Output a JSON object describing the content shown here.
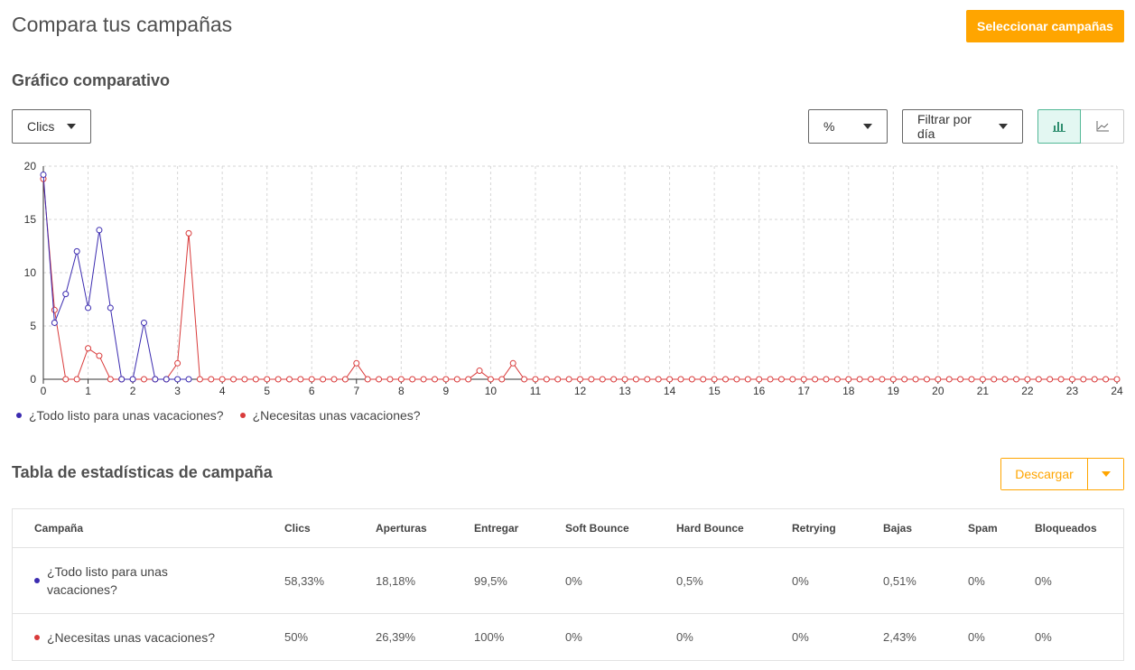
{
  "page": {
    "title": "Compara tus campañas",
    "select_button": "Seleccionar campañas"
  },
  "chart_section": {
    "title": "Gráfico comparativo",
    "metric_select": "Clics",
    "unit_select": "%",
    "filter_select": "Filtrar por día",
    "view_bar_icon": "bar-chart-icon",
    "view_line_icon": "line-chart-icon"
  },
  "chart_data": {
    "type": "line",
    "x": [
      0,
      0.25,
      0.5,
      0.75,
      1,
      1.25,
      1.5,
      1.75,
      2,
      2.25,
      2.5,
      2.75,
      3,
      3.25,
      3.5,
      3.75,
      4,
      4.25,
      4.5,
      4.75,
      5,
      5.25,
      5.5,
      5.75,
      6,
      6.25,
      6.5,
      6.75,
      7,
      7.25,
      7.5,
      7.75,
      8,
      8.25,
      8.5,
      8.75,
      9,
      9.25,
      9.5,
      9.75,
      10,
      10.25,
      10.5,
      10.75,
      11,
      11.25,
      11.5,
      11.75,
      12,
      12.25,
      12.5,
      12.75,
      13,
      13.25,
      13.5,
      13.75,
      14,
      14.25,
      14.5,
      14.75,
      15,
      15.25,
      15.5,
      15.75,
      16,
      16.25,
      16.5,
      16.75,
      17,
      17.25,
      17.5,
      17.75,
      18,
      18.25,
      18.5,
      18.75,
      19,
      19.25,
      19.5,
      19.75,
      20,
      20.25,
      20.5,
      20.75,
      21,
      21.25,
      21.5,
      21.75,
      22,
      22.25,
      22.5,
      22.75,
      23,
      23.25,
      23.5,
      23.75,
      24
    ],
    "series": [
      {
        "name": "¿Todo listo para unas vacaciones?",
        "color": "#3b2bb0",
        "values": [
          19.2,
          5.3,
          8,
          12,
          6.7,
          14,
          6.7,
          0,
          0,
          5.3,
          0,
          0,
          0,
          0
        ]
      },
      {
        "name": "¿Necesitas unas vacaciones?",
        "color": "#d93b3b",
        "values": [
          18.8,
          6.5,
          0,
          0,
          2.9,
          2.2,
          0,
          0,
          0,
          0,
          0,
          0,
          1.5,
          13.7,
          0,
          0,
          0,
          0,
          0,
          0,
          0,
          0,
          0,
          0,
          0,
          0,
          0,
          0,
          1.5,
          0,
          0,
          0,
          0,
          0,
          0,
          0,
          0,
          0,
          0,
          0.8,
          0,
          0,
          1.5,
          0,
          0,
          0,
          0,
          0,
          0,
          0,
          0,
          0,
          0,
          0,
          0,
          0,
          0,
          0,
          0,
          0,
          0,
          0,
          0,
          0,
          0,
          0,
          0,
          0,
          0,
          0,
          0,
          0,
          0,
          0,
          0,
          0,
          0,
          0,
          0,
          0,
          0,
          0,
          0,
          0,
          0,
          0,
          0,
          0,
          0,
          0,
          0,
          0,
          0,
          0,
          0,
          0,
          0
        ]
      }
    ],
    "ylim": [
      0,
      20
    ],
    "yticks": [
      0,
      5,
      10,
      15,
      20
    ],
    "xticks": [
      0,
      1,
      2,
      3,
      4,
      5,
      6,
      7,
      8,
      9,
      10,
      11,
      12,
      13,
      14,
      15,
      16,
      17,
      18,
      19,
      20,
      21,
      22,
      23,
      24
    ],
    "grid": true,
    "legend_position": "bottom-left"
  },
  "table_section": {
    "title": "Tabla de estadísticas de campaña",
    "download_button": "Descargar",
    "columns": [
      "Campaña",
      "Clics",
      "Aperturas",
      "Entregar",
      "Soft Bounce",
      "Hard Bounce",
      "Retrying",
      "Bajas",
      "Spam",
      "Bloqueados"
    ],
    "rows": [
      {
        "campaign": "¿Todo listo para unas vacaciones?",
        "color": "#3b2bb0",
        "values": [
          "58,33%",
          "18,18%",
          "99,5%",
          "0%",
          "0,5%",
          "0%",
          "0,51%",
          "0%",
          "0%"
        ]
      },
      {
        "campaign": "¿Necesitas unas vacaciones?",
        "color": "#d93b3b",
        "values": [
          "50%",
          "26,39%",
          "100%",
          "0%",
          "0%",
          "0%",
          "2,43%",
          "0%",
          "0%"
        ]
      }
    ]
  }
}
